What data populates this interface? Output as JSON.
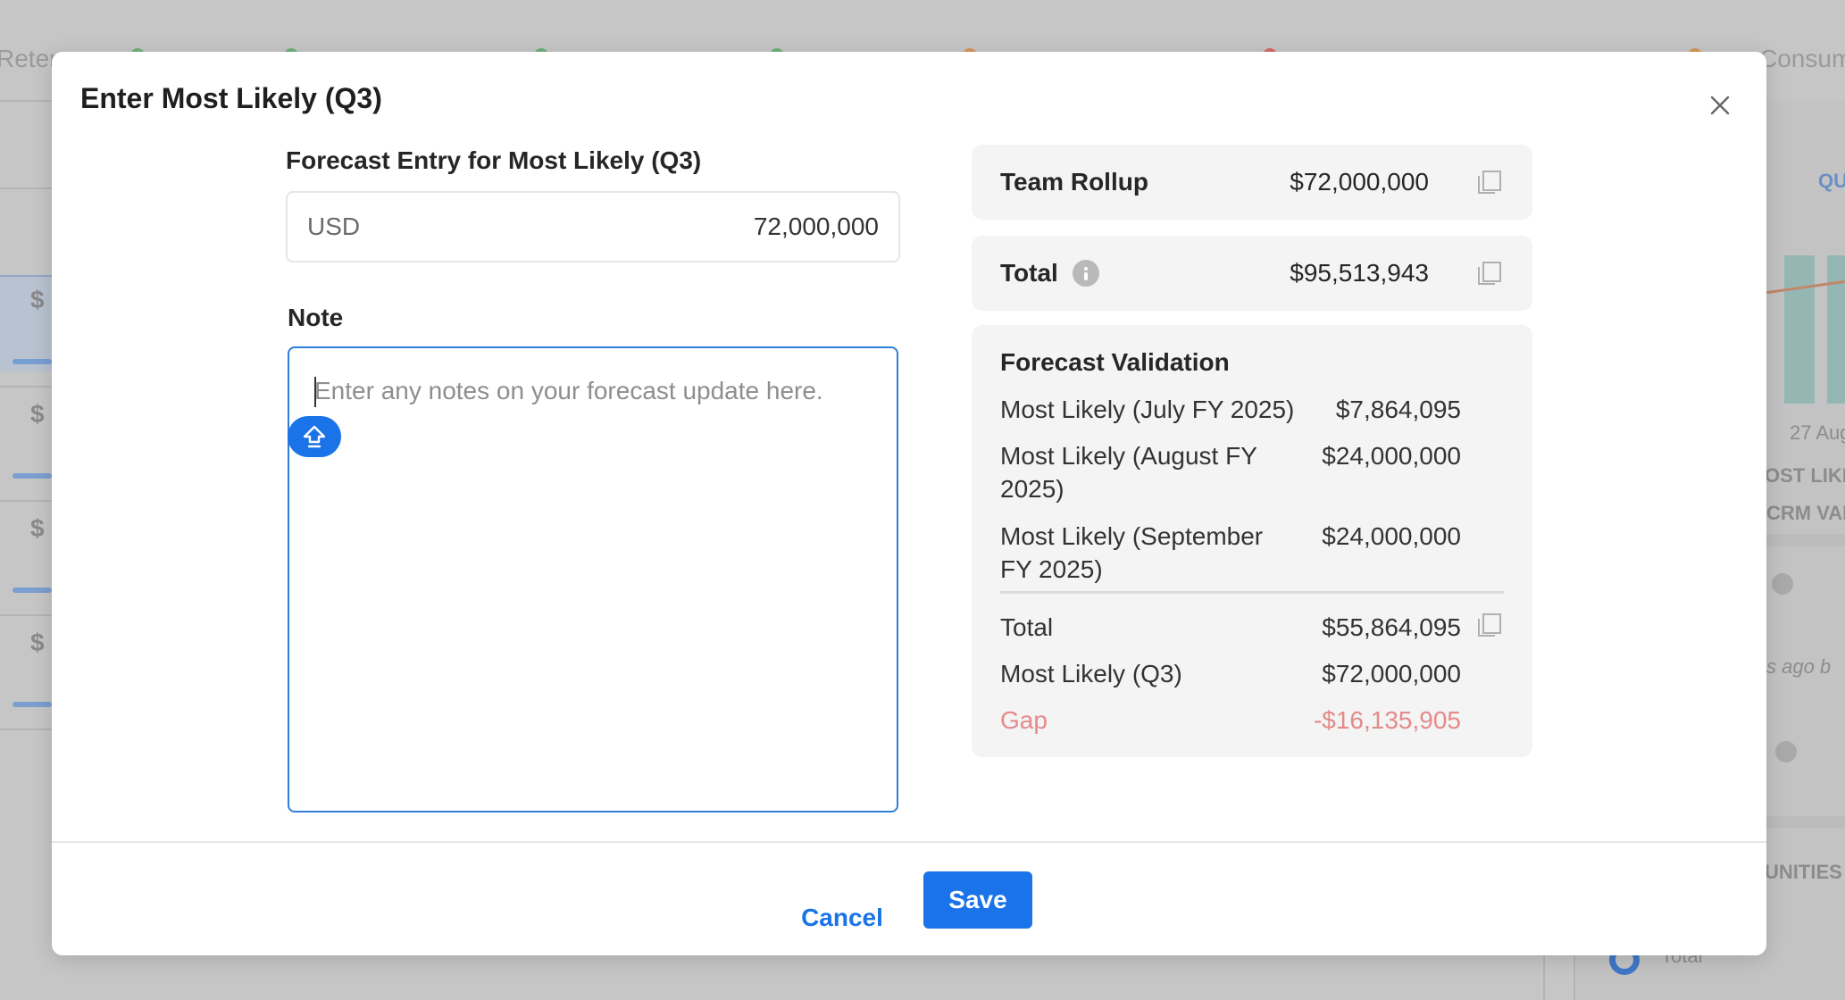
{
  "background": {
    "tab_left_label": "Reten",
    "tab_right_label": "Consum",
    "left_amounts": [
      "$",
      "$",
      "$",
      "$"
    ],
    "right_labels": {
      "tab": "QU",
      "date": "27 Aug",
      "col1": "OST LIKEL",
      "col2": "CRM VAL",
      "ago": "s ago b",
      "section": "UNITIES",
      "total": "Total"
    }
  },
  "modal": {
    "title": "Enter Most Likely (Q3)",
    "close_label": "×"
  },
  "forecast_entry": {
    "label": "Forecast Entry for Most Likely (Q3)",
    "currency": "USD",
    "value": "72,000,000"
  },
  "note": {
    "label": "Note",
    "placeholder": "Enter any notes on your forecast update here."
  },
  "team_rollup": {
    "label": "Team Rollup",
    "value": "$72,000,000"
  },
  "total_card": {
    "label": "Total",
    "value": "$95,513,943"
  },
  "forecast_validation": {
    "title": "Forecast Validation",
    "rows": [
      {
        "label": "Most Likely (July FY 2025)",
        "value": "$7,864,095"
      },
      {
        "label": "Most Likely (August FY 2025)",
        "value": "$24,000,000"
      },
      {
        "label": "Most Likely (September FY 2025)",
        "value": "$24,000,000"
      }
    ],
    "total": {
      "label": "Total",
      "value": "$55,864,095"
    },
    "most_likely": {
      "label": "Most Likely (Q3)",
      "value": "$72,000,000"
    },
    "gap": {
      "label": "Gap",
      "value": "-$16,135,905"
    }
  },
  "footer": {
    "cancel_label": "Cancel",
    "save_label": "Save"
  },
  "colors": {
    "accent": "#1a73e8",
    "gap": "#e58a8a",
    "card_bg": "#f4f4f4"
  }
}
